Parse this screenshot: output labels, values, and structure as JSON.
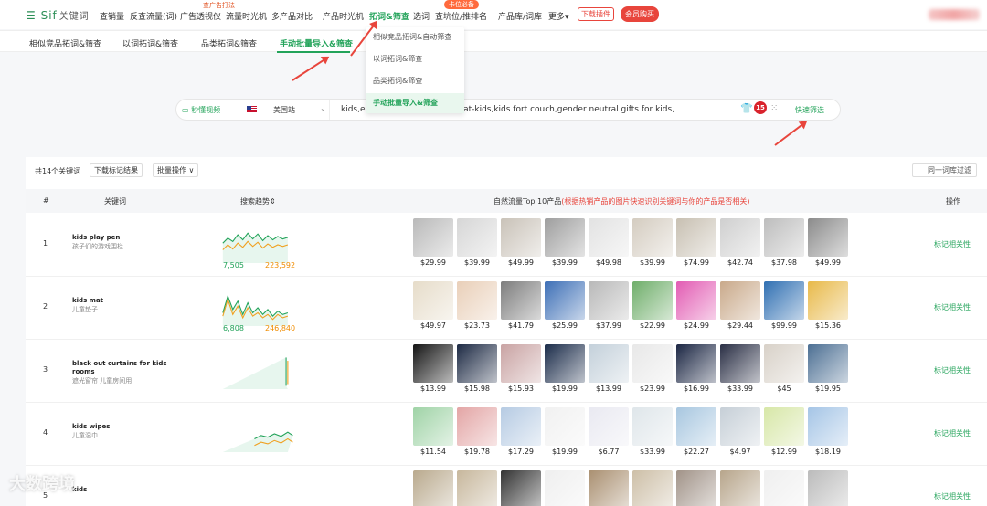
{
  "nav": {
    "logo": "Sif",
    "brand": "关键词",
    "items": [
      "查销量",
      "反查流量(词)",
      "广告透视仪",
      "流量时光机",
      "多产品对比",
      "产品时光机",
      "拓词&筛查",
      "选词",
      "查坑位/推排名",
      "产品库/词库",
      "更多"
    ],
    "more_caret": "▾",
    "tag_ad": "查广告打法",
    "tag_pos": "卡位必备",
    "download_plugin": "下载插件",
    "buy_vip": "会员购买"
  },
  "subtabs": [
    "相似竞品拓词&筛查",
    "以词拓词&筛查",
    "品类拓词&筛查",
    "手动批量导入&筛查"
  ],
  "dropdown": [
    "相似竞品拓词&自动筛查",
    "以词拓词&筛查",
    "品类拓词&筛查",
    "手动批量导入&筛查"
  ],
  "search": {
    "video_btn": "秒懂视频",
    "site": "美国站",
    "keywords": "kids,eco-kids-cotton,cotton-mat-kids,kids fort couch,gender neutral gifts for kids,",
    "count": "15",
    "filter_btn": "快速筛选"
  },
  "toolbar": {
    "total": "共14个关键词",
    "download": "下载标记结果",
    "batch": "批量操作",
    "batch_caret": "∨",
    "lexicon_filter": "同一词库过滤"
  },
  "table": {
    "headers": {
      "index": "#",
      "keyword": "关键词",
      "trend": "搜索趋势",
      "top10": "自然流量Top 10产品",
      "top10_note": "(根据热销产品的图片快速识别关键词与你的产品是否相关)",
      "action": "操作"
    },
    "action_label": "标记相关性",
    "rows": [
      {
        "index": "1",
        "keyword": "kids play pen",
        "keyword_cn": "孩子们的游戏围栏",
        "min": "7,505",
        "max": "223,592",
        "prices": [
          "$29.99",
          "$39.99",
          "$49.99",
          "$39.99",
          "$49.98",
          "$39.99",
          "$74.99",
          "$42.74",
          "$37.98",
          "$49.99"
        ]
      },
      {
        "index": "2",
        "keyword": "kids mat",
        "keyword_cn": "儿童垫子",
        "min": "6,808",
        "max": "246,840",
        "prices": [
          "$49.97",
          "$23.73",
          "$41.79",
          "$25.99",
          "$37.99",
          "$22.99",
          "$24.99",
          "$29.44",
          "$99.99",
          "$15.36"
        ]
      },
      {
        "index": "3",
        "keyword": "black out curtains for kids rooms",
        "keyword_cn": "遮光窗帘 儿童房间用",
        "min": "",
        "max": "",
        "prices": [
          "$13.99",
          "$15.98",
          "$15.93",
          "$19.99",
          "$13.99",
          "$23.99",
          "$16.99",
          "$33.99",
          "$45",
          "$19.95"
        ]
      },
      {
        "index": "4",
        "keyword": "kids wipes",
        "keyword_cn": "儿童湿巾",
        "min": "",
        "max": "",
        "prices": [
          "$11.54",
          "$19.78",
          "$17.29",
          "$19.99",
          "$6.77",
          "$33.99",
          "$22.27",
          "$4.97",
          "$12.99",
          "$18.19"
        ]
      },
      {
        "index": "5",
        "keyword": "kids",
        "keyword_cn": "",
        "min": "",
        "max": "",
        "prices": []
      }
    ]
  },
  "watermark": "大数跨境"
}
